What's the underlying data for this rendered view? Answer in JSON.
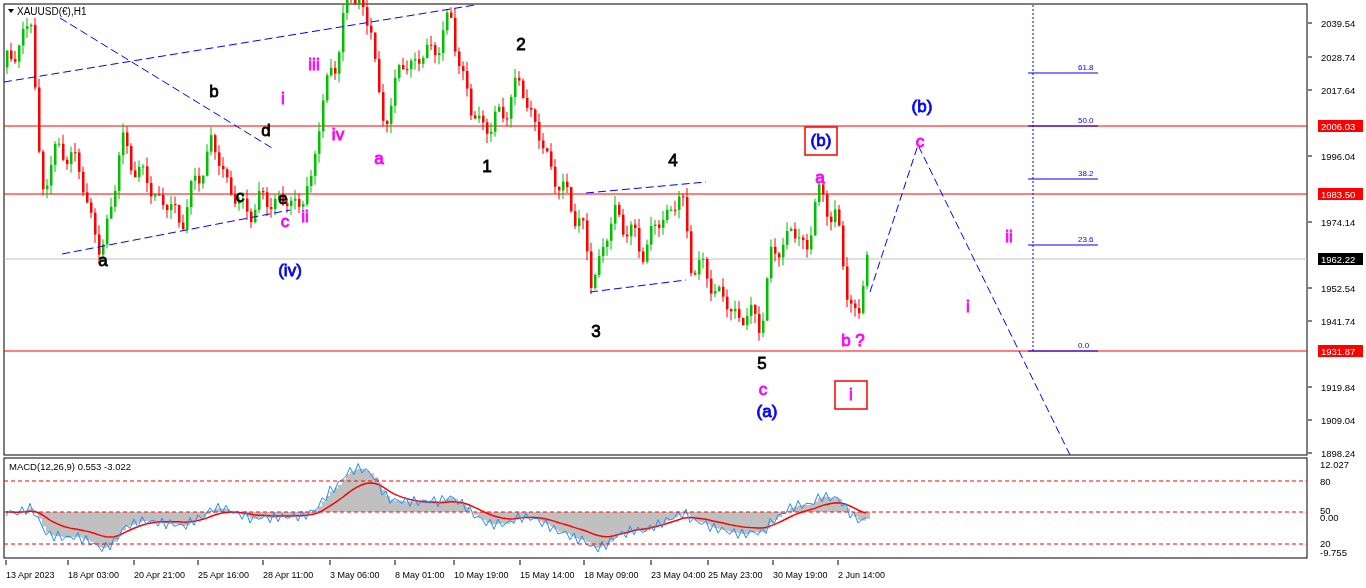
{
  "chart": {
    "title": "XAUUSD(€),H1",
    "price_ticks": [
      "2039.54",
      "2028.74",
      "2017.64",
      "1996.04",
      "1974.14",
      "1952.54",
      "1941.74",
      "1919.84",
      "1909.04",
      "1898.24"
    ],
    "price_badges": [
      {
        "text": "2006.03",
        "kind": "level"
      },
      {
        "text": "1983.50",
        "kind": "level"
      },
      {
        "text": "1962.22",
        "kind": "current"
      },
      {
        "text": "1931.87",
        "kind": "level"
      }
    ],
    "fib_levels": [
      "61.8",
      "50.0",
      "38.2",
      "23.6",
      "0.0"
    ],
    "wave_labels": [
      {
        "text": "a",
        "color": "#000000",
        "boxed": false
      },
      {
        "text": "b",
        "color": "#000000",
        "boxed": false
      },
      {
        "text": "c",
        "color": "#000000",
        "boxed": false
      },
      {
        "text": "d",
        "color": "#000000",
        "boxed": false
      },
      {
        "text": "e",
        "color": "#000000",
        "boxed": false
      },
      {
        "text": "1",
        "color": "#000000",
        "boxed": false
      },
      {
        "text": "2",
        "color": "#000000",
        "boxed": false
      },
      {
        "text": "3",
        "color": "#000000",
        "boxed": false
      },
      {
        "text": "4",
        "color": "#000000",
        "boxed": false
      },
      {
        "text": "5",
        "color": "#000000",
        "boxed": false
      },
      {
        "text": "i",
        "color": "#ff00ff",
        "boxed": false
      },
      {
        "text": "iii",
        "color": "#ff00ff",
        "boxed": false
      },
      {
        "text": "iv",
        "color": "#ff00ff",
        "boxed": false
      },
      {
        "text": "ii",
        "color": "#ff00ff",
        "boxed": false
      },
      {
        "text": "c",
        "color": "#ff00ff",
        "boxed": false
      },
      {
        "text": "a",
        "color": "#ff00ff",
        "boxed": false
      },
      {
        "text": "a",
        "color": "#ff00ff",
        "boxed": false
      },
      {
        "text": "c",
        "color": "#ff00ff",
        "boxed": false
      },
      {
        "text": "b ?",
        "color": "#ff00ff",
        "boxed": false
      },
      {
        "text": "c",
        "color": "#ff00ff",
        "boxed": false
      },
      {
        "text": "ii",
        "color": "#ff00ff",
        "boxed": false
      },
      {
        "text": "i",
        "color": "#ff00ff",
        "boxed": false
      },
      {
        "text": "(iv)",
        "color": "#0000ff",
        "boxed": false
      },
      {
        "text": "(b)",
        "color": "#0000ff",
        "boxed": false
      },
      {
        "text": "(a)",
        "color": "#0000ff",
        "boxed": false
      },
      {
        "text": "(b)",
        "color": "#0000ff",
        "boxed": true
      },
      {
        "text": "i",
        "color": "#ff00ff",
        "boxed": true
      }
    ]
  },
  "indicator": {
    "title": "MACD(12,26,9) 0.553 -3.022",
    "scale": [
      "12.027",
      "80",
      "50",
      "0.00",
      "20",
      "-9.755"
    ]
  },
  "time_axis": [
    "13 Apr 2023",
    "18 Apr 03:00",
    "20 Apr 21:00",
    "25 Apr 16:00",
    "28 Apr 11:00",
    "3 May 06:00",
    "8 May 01:00",
    "10 May 19:00",
    "15 May 14:00",
    "18 May 09:00",
    "23 May 04:00",
    "25 May 23:00",
    "30 May 19:00",
    "2 Jun 14:00"
  ]
}
